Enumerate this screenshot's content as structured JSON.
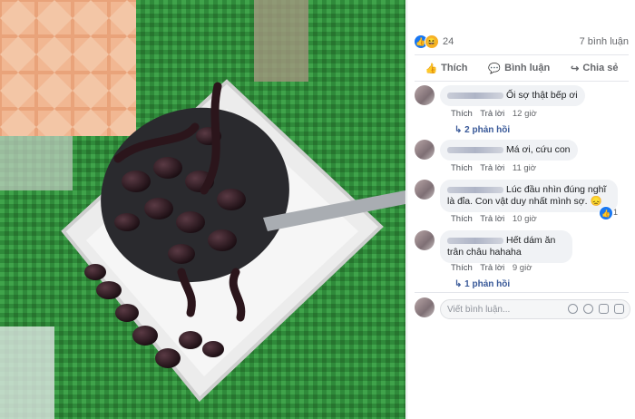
{
  "post": {
    "reaction_count": "24",
    "comment_count": "7 bình luận",
    "actions": {
      "like": "Thích",
      "comment": "Bình luận",
      "share": "Chia sẻ"
    },
    "colors": {
      "like_blue": "#1877f2",
      "haha_yellow": "#f7b125",
      "link": "#385898"
    }
  },
  "comments": [
    {
      "text": "Ối sợ thật bếp ơi",
      "like": "Thích",
      "reply": "Trả lời",
      "time": "12 giờ",
      "replies": "2 phản hồi"
    },
    {
      "text": "Má ơi, cứu con",
      "like": "Thích",
      "reply": "Trả lời",
      "time": "11 giờ"
    },
    {
      "text": "Lúc đầu nhìn đúng nghĩ là đỉa. Con vật duy nhất mình sợ. 😞",
      "like": "Thích",
      "reply": "Trả lời",
      "time": "10 giờ",
      "reaction_count": "1"
    },
    {
      "text": "Hết dám ăn trân châu hahaha",
      "like": "Thích",
      "reply": "Trả lời",
      "time": "9 giờ",
      "replies": "1 phản hồi"
    }
  ],
  "composer": {
    "placeholder": "Viết bình luận..."
  }
}
